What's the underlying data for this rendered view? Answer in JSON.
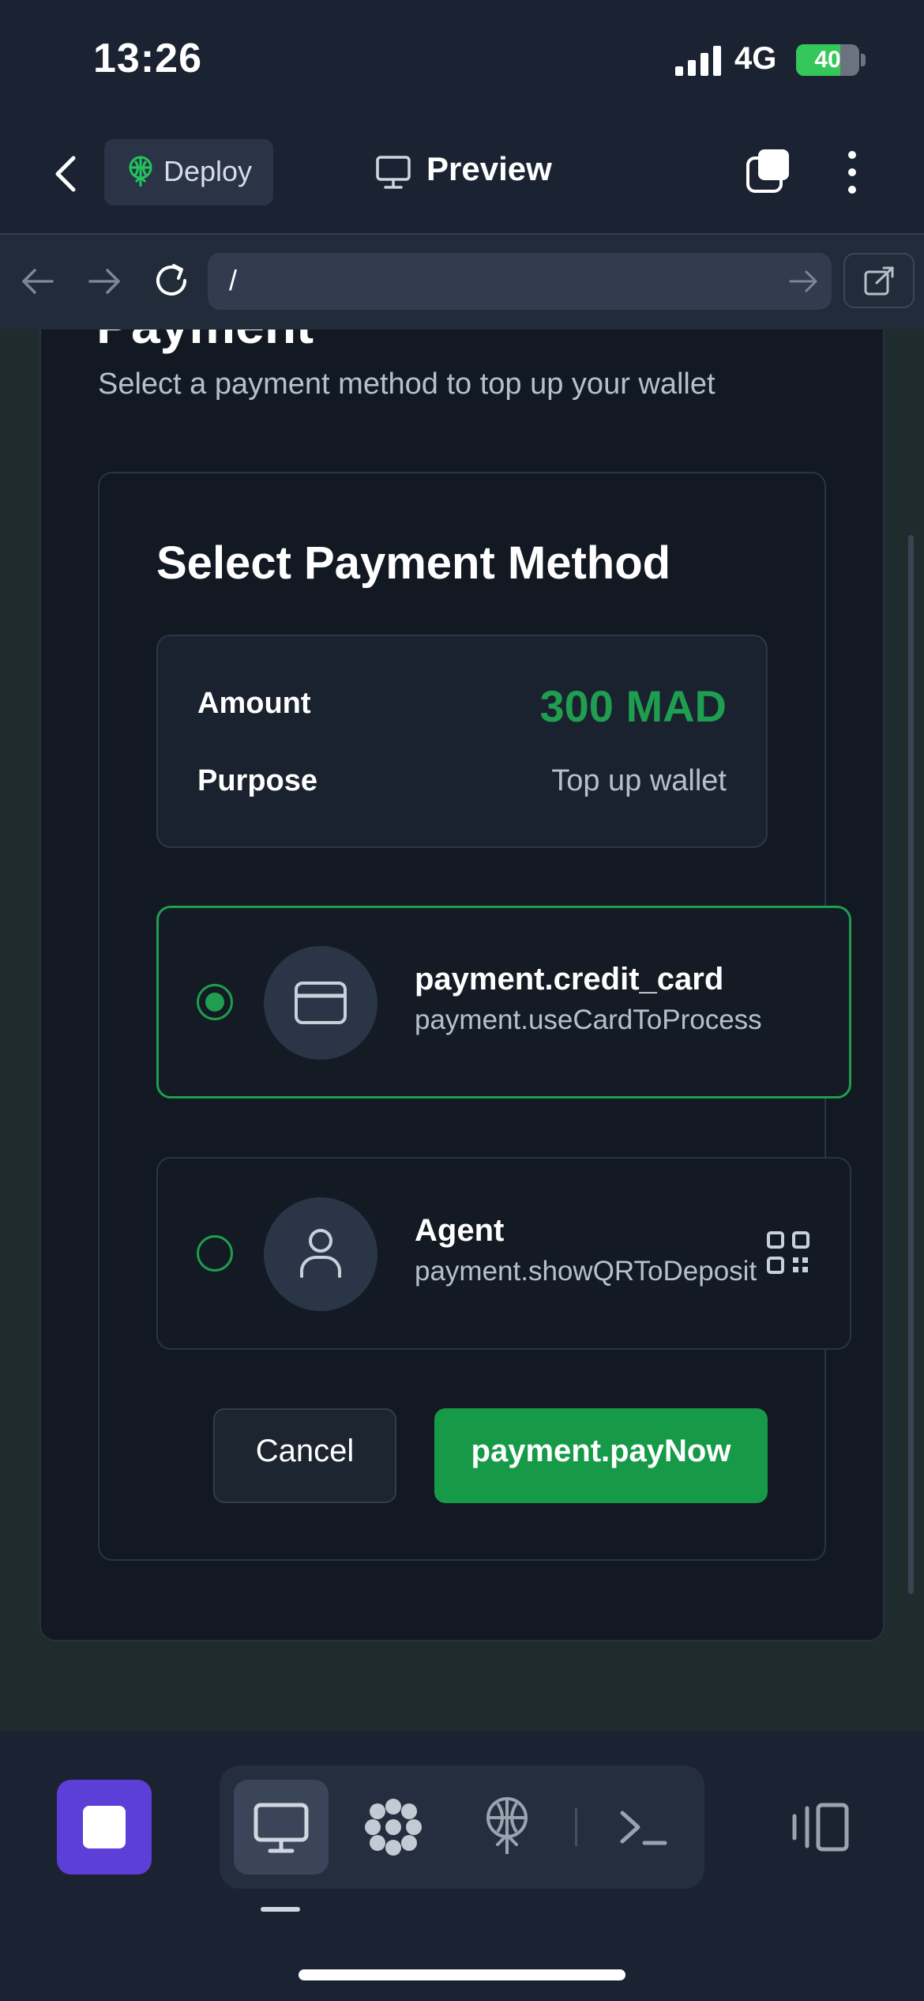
{
  "status_bar": {
    "time": "13:26",
    "network": "4G",
    "battery": "40"
  },
  "toolbar": {
    "deploy_label": "Deploy",
    "preview_label": "Preview"
  },
  "browser": {
    "url": "/"
  },
  "page": {
    "title": "Payment",
    "subtitle": "Select a payment method to top up your wallet",
    "method_title": "Select Payment Method",
    "summary": {
      "amount_label": "Amount",
      "amount_value": "300 MAD",
      "purpose_label": "Purpose",
      "purpose_value": "Top up wallet"
    },
    "options": [
      {
        "title": "payment.credit_card",
        "subtitle": "payment.useCardToProcess",
        "selected": true,
        "icon": "credit-card-icon"
      },
      {
        "title": "Agent",
        "subtitle": "payment.showQRToDeposit",
        "selected": false,
        "icon": "user-icon"
      }
    ],
    "cancel_label": "Cancel",
    "pay_label": "payment.payNow"
  },
  "colors": {
    "accent": "#1e9e4e",
    "stop_button": "#5b3fd6",
    "background": "#1b2332"
  },
  "bottom_tools": [
    "desktop-icon",
    "grid-apps-icon",
    "deploy-icon",
    "terminal-icon",
    "panel-icon"
  ]
}
